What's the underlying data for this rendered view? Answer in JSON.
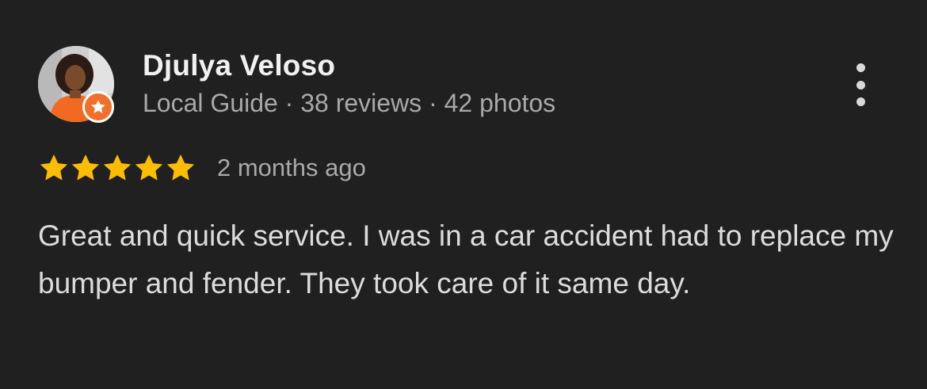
{
  "reviewer": {
    "name": "Djulya Veloso",
    "badge": "Local Guide",
    "separator": "·",
    "reviews": "38 reviews",
    "photos": "42 photos",
    "avatar_icon": "user-photo-avatar",
    "badge_icon": "local-guide-star-icon",
    "badge_color": "#f0702b"
  },
  "menu": {
    "icon": "more-vert-icon"
  },
  "rating": {
    "stars": 5,
    "max_stars": 5,
    "star_color": "#fbbc04",
    "time": "2 months ago"
  },
  "review": {
    "text": "Great and quick service. I was in a car accident had to replace my bumper and fender. They took care of it same day."
  }
}
